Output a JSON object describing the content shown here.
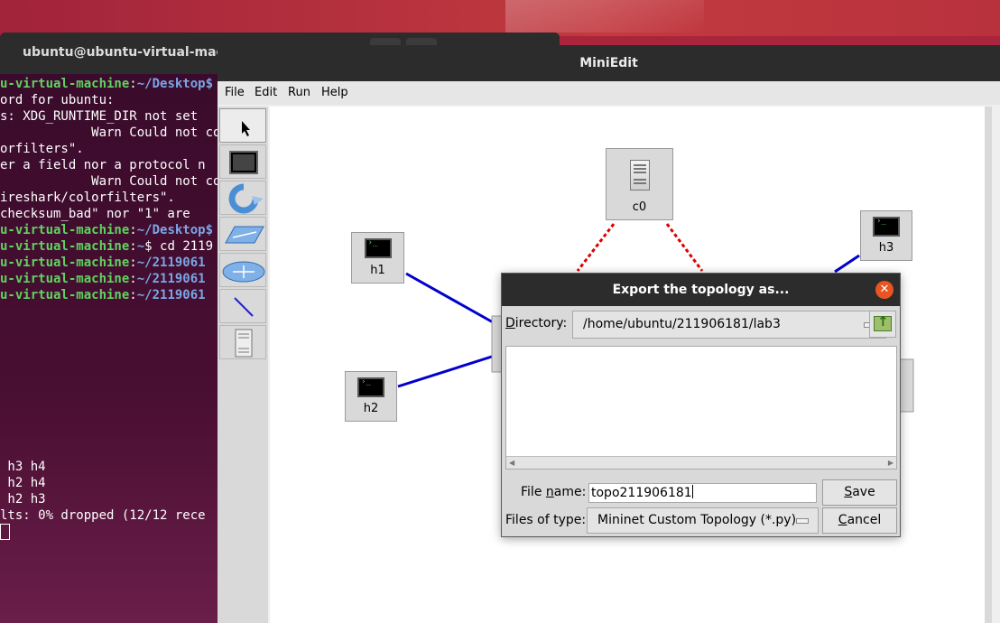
{
  "terminal": {
    "title": "ubuntu@ubuntu-virtual-machi",
    "lines": [
      {
        "green": "u-virtual-machine",
        "sep": ":",
        "blue": "~/Desktop$",
        "rest": ""
      },
      {
        "green": "",
        "sep": "",
        "blue": "",
        "rest": "ord for ubuntu:"
      },
      {
        "green": "",
        "sep": "",
        "blue": "",
        "rest": "s: XDG_RUNTIME_DIR not set"
      },
      {
        "green": "",
        "sep": "",
        "blue": "",
        "rest": "            Warn Could not con"
      },
      {
        "green": "",
        "sep": "",
        "blue": "",
        "rest": "orfilters\"."
      },
      {
        "green": "",
        "sep": "",
        "blue": "",
        "rest": "er a field nor a protocol n"
      },
      {
        "green": "",
        "sep": "",
        "blue": "",
        "rest": "            Warn Could not con"
      },
      {
        "green": "",
        "sep": "",
        "blue": "",
        "rest": "ireshark/colorfilters\"."
      },
      {
        "green": "",
        "sep": "",
        "blue": "",
        "rest": "checksum_bad\" nor \"1\" are"
      },
      {
        "green": "u-virtual-machine",
        "sep": ":",
        "blue": "~/Desktop$",
        "rest": ""
      },
      {
        "green": "u-virtual-machine",
        "sep": ":",
        "blue": "~",
        "rest": "$ cd 2119"
      },
      {
        "green": "u-virtual-machine",
        "sep": ":",
        "blue": "~/2119061",
        "rest": ""
      },
      {
        "green": "u-virtual-machine",
        "sep": ":",
        "blue": "~/2119061",
        "rest": ""
      },
      {
        "green": "u-virtual-machine",
        "sep": ":",
        "blue": "~/2119061",
        "rest": ""
      }
    ],
    "bottom_lines": [
      " h3 h4",
      " h2 h4",
      " h2 h3",
      "lts: 0% dropped (12/12 rece"
    ]
  },
  "miniedit": {
    "title": "MiniEdit",
    "menu": [
      "File",
      "Edit",
      "Run",
      "Help"
    ],
    "nodes": {
      "c0": "c0",
      "h1": "h1",
      "h2": "h2",
      "h3": "h3"
    }
  },
  "dialog": {
    "title": "Export the topology as...",
    "directory_label_u": "D",
    "directory_label_rest": "irectory:",
    "directory_value": "/home/ubuntu/211906181/lab3",
    "filename_label_pre": "File ",
    "filename_label_u": "n",
    "filename_label_post": "ame:",
    "filename_value": "topo211906181",
    "filetype_label": "Files of type:",
    "filetype_value": "Mininet Custom Topology (*.py)",
    "save_u": "S",
    "save_rest": "ave",
    "cancel_u": "C",
    "cancel_rest": "ancel"
  },
  "colors": {
    "accent": "#e95420",
    "link": "#0000cc",
    "controller_link": "#dd0000",
    "prompt_green": "#5fd35f",
    "prompt_blue": "#7aa6e6"
  }
}
